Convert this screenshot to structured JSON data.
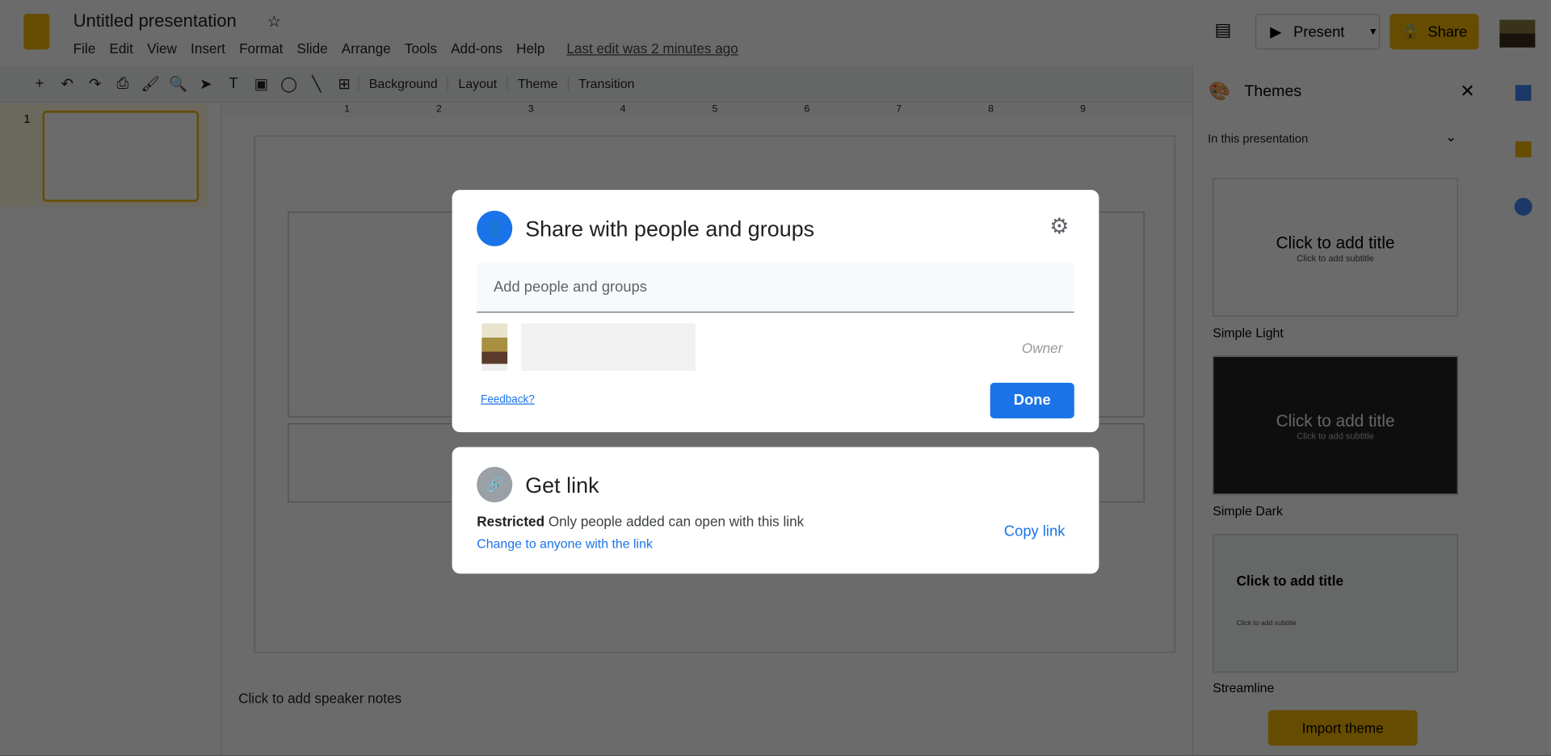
{
  "app": {
    "title": "Untitled presentation",
    "last_edit": "Last edit was 2 minutes ago",
    "menu": [
      "File",
      "Edit",
      "View",
      "Insert",
      "Format",
      "Slide",
      "Arrange",
      "Tools",
      "Add-ons",
      "Help"
    ],
    "present_label": "Present",
    "share_label": "Share"
  },
  "toolbar": {
    "background": "Background",
    "layout": "Layout",
    "theme": "Theme",
    "transition": "Transition"
  },
  "slides": {
    "number": "1"
  },
  "ruler": [
    "1",
    "2",
    "3",
    "4",
    "5",
    "6",
    "7",
    "8",
    "9"
  ],
  "notes_placeholder": "Click to add speaker notes",
  "themes": {
    "title": "Themes",
    "filter": "In this presentation",
    "items": [
      {
        "name": "Simple Light",
        "title": "Click to add title",
        "subtitle": "Click to add subtitle"
      },
      {
        "name": "Simple Dark",
        "title": "Click to add title",
        "subtitle": "Click to add subtitle"
      },
      {
        "name": "Streamline",
        "title": "Click to add title",
        "subtitle": "Click to add subtitle"
      }
    ],
    "import": "Import theme"
  },
  "share_dialog": {
    "title": "Share with people and groups",
    "input_placeholder": "Add people and groups",
    "owner_role": "Owner",
    "feedback": "Feedback?",
    "done": "Done"
  },
  "get_link": {
    "title": "Get link",
    "restriction": "Restricted",
    "description": "Only people added can open with this link",
    "change": "Change to anyone with the link",
    "copy": "Copy link"
  },
  "colors": {
    "accent": "#1a73e8",
    "share_yellow": "#f4b400"
  }
}
